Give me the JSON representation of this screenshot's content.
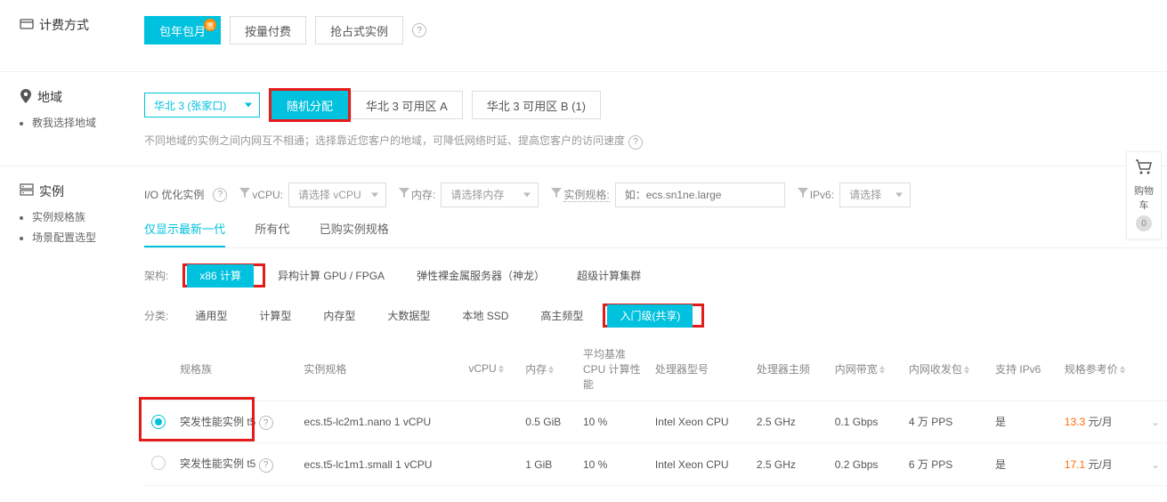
{
  "billing": {
    "label": "计费方式",
    "options": [
      "包年包月",
      "按量付费",
      "抢占式实例"
    ],
    "badge": "惠"
  },
  "region": {
    "label": "地域",
    "helpLink": "教我选择地域",
    "selected": "华北 3 (张家口)",
    "zones": [
      "随机分配",
      "华北 3 可用区 A",
      "华北 3 可用区 B (1)"
    ],
    "hint": "不同地域的实例之间内网互不相通；选择靠近您客户的地域，可降低网络时延、提高您客户的访问速度"
  },
  "instance": {
    "label": "实例",
    "subs": [
      "实例规格族",
      "场景配置选型"
    ],
    "ioLabel": "I/O 优化实例",
    "filters": {
      "vcpu_label": "vCPU:",
      "vcpu_ph": "请选择 vCPU",
      "mem_label": "内存:",
      "mem_ph": "请选择内存",
      "spec_label": "实例规格:",
      "spec_ph": "如：ecs.sn1ne.large",
      "ipv6_label": "IPv6:",
      "ipv6_ph": "请选择"
    },
    "tabs": [
      "仅显示最新一代",
      "所有代",
      "已购实例规格"
    ],
    "archLabel": "架构:",
    "arch": [
      "x86 计算",
      "异构计算 GPU / FPGA",
      "弹性裸金属服务器（神龙）",
      "超级计算集群"
    ],
    "catLabel": "分类:",
    "cats": [
      "通用型",
      "计算型",
      "内存型",
      "大数据型",
      "本地 SSD",
      "高主频型",
      "入门级(共享)"
    ]
  },
  "table": {
    "headers": [
      "规格族",
      "实例规格",
      "vCPU",
      "内存",
      "平均基准 CPU 计算性能",
      "处理器型号",
      "处理器主频",
      "内网带宽",
      "内网收发包",
      "支持 IPv6",
      "规格参考价"
    ],
    "rows": [
      {
        "family": "突发性能实例 t5",
        "spec": "ecs.t5-lc2m1.nano",
        "vcpu": "1 vCPU",
        "mem": "0.5 GiB",
        "perf": "10 %",
        "cpu": "Intel Xeon CPU",
        "freq": "2.5 GHz",
        "bw": "0.1 Gbps",
        "pps": "4 万 PPS",
        "ipv6": "是",
        "price": "13.3",
        "unit": " 元/月",
        "checked": true
      },
      {
        "family": "突发性能实例 t5",
        "spec": "ecs.t5-lc1m1.small",
        "vcpu": "1 vCPU",
        "mem": "1 GiB",
        "perf": "10 %",
        "cpu": "Intel Xeon CPU",
        "freq": "2.5 GHz",
        "bw": "0.2 Gbps",
        "pps": "6 万 PPS",
        "ipv6": "是",
        "price": "17.1",
        "unit": " 元/月",
        "checked": false
      }
    ]
  },
  "cart": {
    "label": "购物车",
    "count": "0"
  }
}
